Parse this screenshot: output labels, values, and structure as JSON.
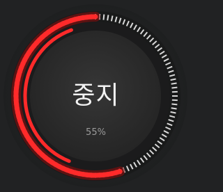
{
  "widget": {
    "status_label": "중지",
    "percent_text": "55%",
    "progress_fraction": 0.55
  },
  "colors": {
    "accent": "#ff2a2a",
    "accent_dark": "#8a0d0d",
    "track": "#2e2f30",
    "center": "#2b2b2b",
    "tick_active": "#d9d9d9",
    "tick_dim": "#4a4a4a",
    "background": "#212223"
  },
  "icons": {
    "gauge": "circular-progress-ring"
  }
}
